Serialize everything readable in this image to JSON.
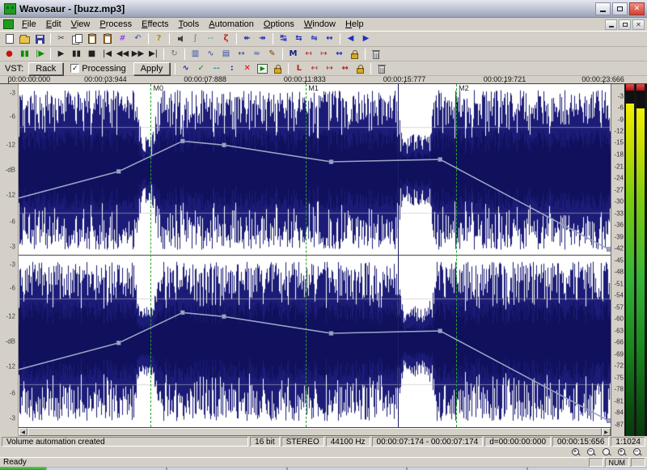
{
  "window": {
    "title": "Wavosaur - [buzz.mp3]"
  },
  "menu": {
    "items": [
      "File",
      "Edit",
      "View",
      "Process",
      "Effects",
      "Tools",
      "Automation",
      "Options",
      "Window",
      "Help"
    ]
  },
  "toolbar_main": {
    "groups": [
      [
        {
          "n": "new-file-button",
          "s": "new"
        },
        {
          "n": "open-file-button",
          "s": "open"
        },
        {
          "n": "save-file-button",
          "s": "save"
        }
      ],
      [
        {
          "n": "cut-button",
          "g": "✂",
          "c": "#404040"
        },
        {
          "n": "copy-button",
          "s": "copy"
        },
        {
          "n": "paste-button",
          "s": "paste"
        },
        {
          "n": "paste-mix-button",
          "s": "paste"
        },
        {
          "n": "trim-button",
          "g": "#",
          "c": "#8a2be2"
        },
        {
          "n": "undo-button",
          "g": "↶",
          "c": "#3050b0"
        }
      ],
      [
        {
          "n": "help-button",
          "g": "?",
          "c": "#b09000",
          "b": true
        }
      ],
      [
        {
          "n": "audio-config-button",
          "s": "speaker"
        },
        {
          "n": "interpolate-button",
          "g": "ʃ",
          "c": "#607090"
        },
        {
          "n": "dashed-line-button",
          "g": "--",
          "c": "#20a0a0"
        },
        {
          "n": "settings-wrench-button",
          "g": "ζ",
          "c": "#c02020",
          "b": true
        }
      ],
      [
        {
          "n": "zoom-out-full-button",
          "g": "↞",
          "c": "#2030c0",
          "b": true
        },
        {
          "n": "zoom-selection-button",
          "g": "↠",
          "c": "#2030c0",
          "b": true
        }
      ],
      [
        {
          "n": "zoom-all-button",
          "g": "↹",
          "c": "#2030c0",
          "b": true
        },
        {
          "n": "zoom-in-horizontal-button",
          "g": "⇆",
          "c": "#2030c0",
          "b": true
        },
        {
          "n": "zoom-out-horizontal-button",
          "g": "⇋",
          "c": "#2030c0",
          "b": true
        },
        {
          "n": "zoom-vertical-button",
          "g": "↔",
          "c": "#2030c0",
          "b": true
        }
      ],
      [
        {
          "n": "view-previous-button",
          "g": "◀",
          "c": "#2030c0"
        },
        {
          "n": "view-next-button",
          "g": "▶",
          "c": "#2030c0"
        }
      ]
    ]
  },
  "toolbar_transport": {
    "groups": [
      [
        {
          "n": "record-button",
          "g": "●",
          "c": "#cc1010"
        },
        {
          "n": "pause-monitor-button",
          "g": "▮▮",
          "c": "#0a9000"
        },
        {
          "n": "play-from-cursor-button",
          "g": "|▶",
          "c": "#0a9000"
        }
      ],
      [
        {
          "n": "play-button",
          "g": "▶",
          "c": "#202020"
        },
        {
          "n": "pause-button",
          "g": "▮▮",
          "c": "#202020"
        },
        {
          "n": "stop-button",
          "g": "■",
          "c": "#202020"
        },
        {
          "n": "go-to-start-button",
          "g": "|◀",
          "c": "#202020"
        },
        {
          "n": "rewind-button",
          "g": "◀◀",
          "c": "#202020"
        },
        {
          "n": "forward-button",
          "g": "▶▶",
          "c": "#202020"
        },
        {
          "n": "go-to-end-button",
          "g": "▶|",
          "c": "#202020"
        }
      ],
      [
        {
          "n": "loop-button",
          "g": "↻",
          "c": "#707070"
        }
      ],
      [
        {
          "n": "paste-insert-button",
          "g": "▥",
          "c": "#3050a0"
        },
        {
          "n": "statistics-button",
          "g": "∿",
          "c": "#3050a0"
        },
        {
          "n": "duplicate-window-button",
          "g": "▤",
          "c": "#3050a0"
        },
        {
          "n": "zoom-wave-button",
          "g": "↔",
          "c": "#3050a0"
        },
        {
          "n": "mix-button",
          "g": "≈",
          "c": "#3050a0"
        },
        {
          "n": "draw-pencil-button",
          "g": "✎",
          "c": "#804000"
        }
      ],
      [
        {
          "n": "insert-marker-button",
          "g": "M",
          "c": "#102080",
          "b": true
        },
        {
          "n": "previous-marker-button",
          "g": "↤",
          "c": "#c02020"
        },
        {
          "n": "next-marker-button",
          "g": "↦",
          "c": "#c02020"
        },
        {
          "n": "markers-zoom-button",
          "g": "↔",
          "c": "#2030c0",
          "b": true
        },
        {
          "n": "lock-markers-button",
          "s": "lock"
        }
      ],
      [
        {
          "n": "delete-markers-button",
          "s": "trash"
        }
      ]
    ]
  },
  "vst_bar": {
    "label": "VST:",
    "rack_button": "Rack",
    "processing_label": "Processing",
    "processing_checked": "✓",
    "apply_button": "Apply",
    "groups": [
      [
        {
          "n": "show-envelope-button",
          "g": "∿",
          "c": "#2030c0",
          "b": true
        },
        {
          "n": "apply-envelope-button",
          "g": "✓",
          "c": "#0a9000",
          "b": true
        },
        {
          "n": "envelope-points-button",
          "g": "--",
          "c": "#20a0a0",
          "b": true
        },
        {
          "n": "envelope-vertical-button",
          "g": ":",
          "c": "#2030c0",
          "b": true
        },
        {
          "n": "delete-envelope-button",
          "g": "✕",
          "c": "#cc1010",
          "b": true
        },
        {
          "n": "play-envelope-button",
          "s": "playbox"
        },
        {
          "n": "lock-envelope-button",
          "s": "lock"
        }
      ],
      [
        {
          "n": "loop-start-button",
          "g": "L",
          "c": "#c02020",
          "b": true
        },
        {
          "n": "loop-in-button",
          "g": "↤",
          "c": "#c02020"
        },
        {
          "n": "loop-out-button",
          "g": "↦",
          "c": "#c02020"
        },
        {
          "n": "loop-zoom-button",
          "g": "↔",
          "c": "#c02020",
          "b": true
        },
        {
          "n": "lock-loop-button",
          "s": "lock"
        }
      ],
      [
        {
          "n": "delete-loop-button",
          "s": "trash"
        }
      ]
    ]
  },
  "timeline": {
    "labels": [
      "00:00:00:000",
      "00:00:03:944",
      "00:00:07:888",
      "00:00:11:833",
      "00:00:15:777",
      "00:00:19:721",
      "00:00:23:666"
    ],
    "positions": [
      0.012,
      0.163,
      0.317,
      0.471,
      0.625,
      0.78,
      0.932
    ]
  },
  "wave": {
    "db_labels": [
      "-3",
      "-6",
      "-12",
      "-dB",
      "-12",
      "-6",
      "-3"
    ],
    "db_positions": [
      0.05,
      0.19,
      0.355,
      0.5,
      0.645,
      0.8,
      0.95
    ],
    "channels": 2,
    "quiet_regions": [
      [
        0.207,
        0.226
      ],
      [
        0.648,
        0.692
      ]
    ],
    "waveform_color": "#1c1c78"
  },
  "markers": [
    {
      "label": "M0",
      "x": 0.2233
    },
    {
      "label": "M1",
      "x": 0.4854
    },
    {
      "label": "M2",
      "x": 0.7392
    }
  ],
  "cursor_x": 0.6407,
  "automation": {
    "color": "#98a2c6",
    "points": [
      [
        0,
        0.664
      ],
      [
        0.169,
        0.509
      ],
      [
        0.277,
        0.332
      ],
      [
        0.347,
        0.355
      ],
      [
        0.528,
        0.453
      ],
      [
        0.712,
        0.439
      ],
      [
        0.997,
        0.963
      ]
    ]
  },
  "meter": {
    "scale": [
      -3,
      -6,
      -9,
      -12,
      -15,
      -18,
      -21,
      -24,
      -27,
      -30,
      -33,
      -36,
      -39,
      -42,
      -45,
      -48,
      -51,
      -54,
      -57,
      -60,
      -63,
      -66,
      -69,
      -72,
      -75,
      -78,
      -81,
      -84,
      -87
    ],
    "range_db": 90,
    "clip_color": "#c01010",
    "lit_top_fraction": [
      0.055,
      0.068
    ]
  },
  "scrollbar": {
    "left_arrow": "◀",
    "right_arrow": "▶"
  },
  "statusbar": {
    "message": "Volume automation created",
    "fields": [
      "16 bit",
      "STEREO",
      "44100 Hz",
      "00:00:07:174 - 00:00:07:174",
      "d=00:00:00:000",
      "00:00:15:656",
      "1:1024"
    ]
  },
  "zoom_buttons": [
    {
      "n": "zoom-in-button",
      "t": "+"
    },
    {
      "n": "zoom-out-button",
      "t": "−"
    },
    {
      "n": "zoom-reset-button",
      "t": ""
    },
    {
      "n": "zoom-vertical-in-button",
      "t": "+"
    },
    {
      "n": "zoom-vertical-out-button",
      "t": "−"
    }
  ],
  "ready_row": {
    "status": "Ready",
    "cells": [
      "",
      "NUM",
      ""
    ]
  }
}
